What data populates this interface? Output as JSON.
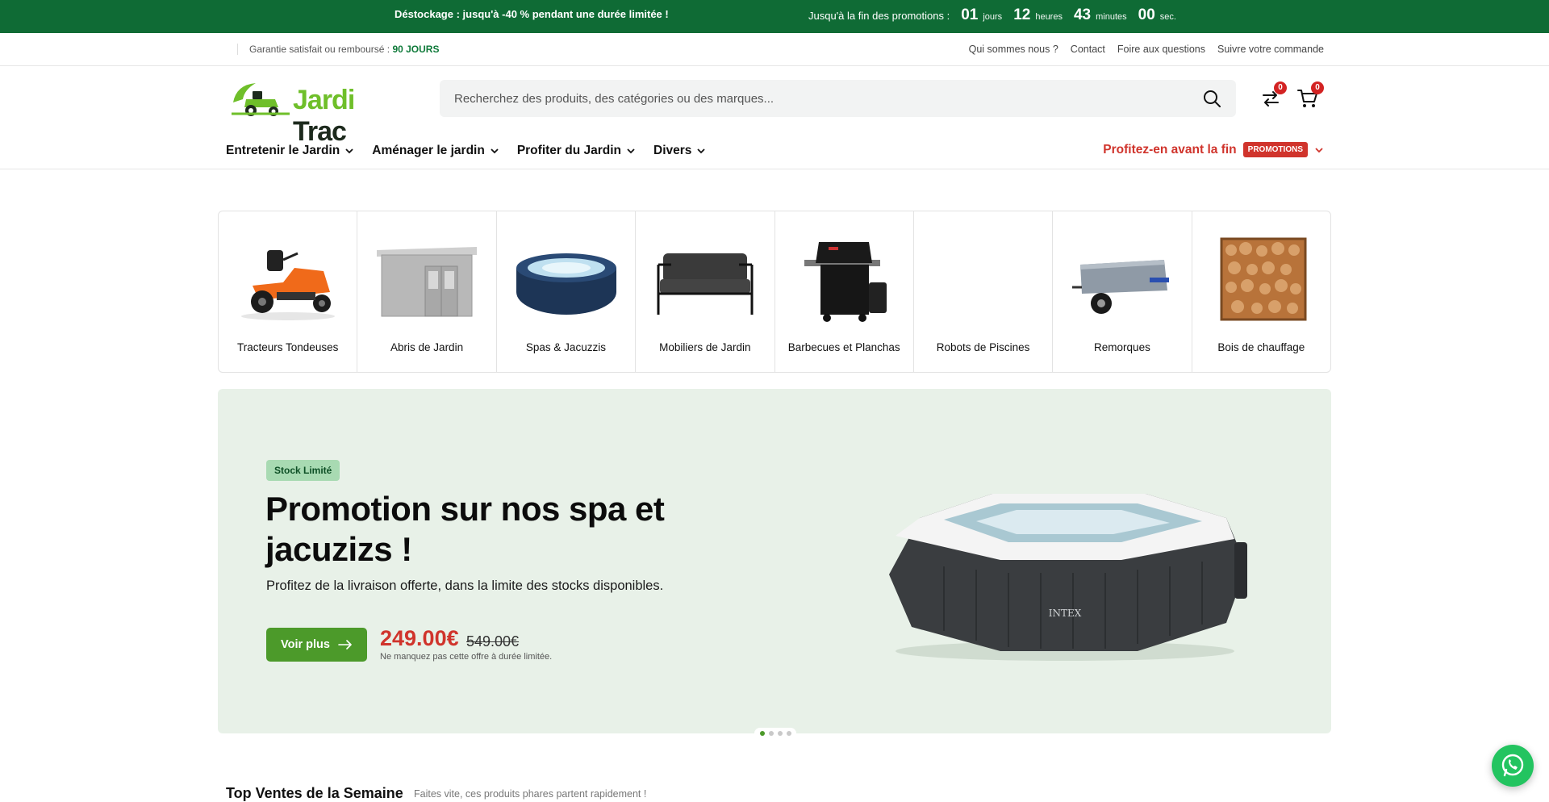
{
  "topbar": {
    "promo": "Déstockage : jusqu'à -40 % pendant une durée limitée !",
    "countdown_label": "Jusqu'à la fin des promotions :",
    "days": "01",
    "days_unit": "jours",
    "hours": "12",
    "hours_unit": "heures",
    "minutes": "43",
    "minutes_unit": "minutes",
    "seconds": "00",
    "seconds_unit": "sec."
  },
  "subbar": {
    "guarantee": "Garantie satisfait ou remboursé :",
    "guarantee_highlight": "90 JOURS",
    "links": [
      "Qui sommes nous ?",
      "Contact",
      "Foire aux questions",
      "Suivre votre commande"
    ]
  },
  "header": {
    "logo_part1": "Jardi",
    "logo_part2": "Trac",
    "search_placeholder": "Recherchez des produits, des catégories ou des marques...",
    "compare_count": "0",
    "cart_count": "0"
  },
  "nav": {
    "items": [
      "Entretenir le Jardin",
      "Aménager le jardin",
      "Profiter du Jardin",
      "Divers"
    ],
    "promo_text": "Profitez-en avant la fin",
    "promo_tag": "PROMOTIONS"
  },
  "categories": [
    "Tracteurs Tondeuses",
    "Abris de Jardin",
    "Spas & Jacuzzis",
    "Mobiliers de Jardin",
    "Barbecues et Planchas",
    "Robots de Piscines",
    "Remorques",
    "Bois de chauffage"
  ],
  "hero": {
    "chip": "Stock Limité",
    "title": "Promotion sur nos spa et jacuzizs !",
    "subtitle": "Profitez de la livraison offerte, dans la limite des stocks disponibles.",
    "button": "Voir plus",
    "price": "249.00€",
    "old_price": "549.00€",
    "note": "Ne manquez pas cette offre à durée limitée.",
    "spa_brand": "INTEX"
  },
  "section": {
    "title": "Top Ventes de la Semaine",
    "subtitle": "Faites vite, ces produits phares partent rapidement !"
  },
  "colors": {
    "topbar": "#0f6b35",
    "accent_green": "#4c9a2a",
    "promo_red": "#d0342c",
    "hero_bg": "#e8f1e8"
  }
}
